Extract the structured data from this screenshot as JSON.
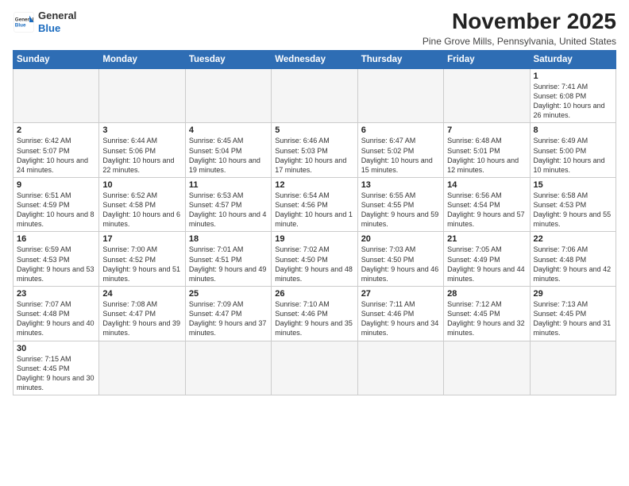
{
  "logo": {
    "general": "General",
    "blue": "Blue"
  },
  "header": {
    "month_year": "November 2025",
    "location": "Pine Grove Mills, Pennsylvania, United States"
  },
  "weekdays": [
    "Sunday",
    "Monday",
    "Tuesday",
    "Wednesday",
    "Thursday",
    "Friday",
    "Saturday"
  ],
  "weeks": [
    [
      {
        "day": "",
        "info": ""
      },
      {
        "day": "",
        "info": ""
      },
      {
        "day": "",
        "info": ""
      },
      {
        "day": "",
        "info": ""
      },
      {
        "day": "",
        "info": ""
      },
      {
        "day": "",
        "info": ""
      },
      {
        "day": "1",
        "info": "Sunrise: 7:41 AM\nSunset: 6:08 PM\nDaylight: 10 hours and 26 minutes."
      }
    ],
    [
      {
        "day": "2",
        "info": "Sunrise: 6:42 AM\nSunset: 5:07 PM\nDaylight: 10 hours and 24 minutes."
      },
      {
        "day": "3",
        "info": "Sunrise: 6:44 AM\nSunset: 5:06 PM\nDaylight: 10 hours and 22 minutes."
      },
      {
        "day": "4",
        "info": "Sunrise: 6:45 AM\nSunset: 5:04 PM\nDaylight: 10 hours and 19 minutes."
      },
      {
        "day": "5",
        "info": "Sunrise: 6:46 AM\nSunset: 5:03 PM\nDaylight: 10 hours and 17 minutes."
      },
      {
        "day": "6",
        "info": "Sunrise: 6:47 AM\nSunset: 5:02 PM\nDaylight: 10 hours and 15 minutes."
      },
      {
        "day": "7",
        "info": "Sunrise: 6:48 AM\nSunset: 5:01 PM\nDaylight: 10 hours and 12 minutes."
      },
      {
        "day": "8",
        "info": "Sunrise: 6:49 AM\nSunset: 5:00 PM\nDaylight: 10 hours and 10 minutes."
      }
    ],
    [
      {
        "day": "9",
        "info": "Sunrise: 6:51 AM\nSunset: 4:59 PM\nDaylight: 10 hours and 8 minutes."
      },
      {
        "day": "10",
        "info": "Sunrise: 6:52 AM\nSunset: 4:58 PM\nDaylight: 10 hours and 6 minutes."
      },
      {
        "day": "11",
        "info": "Sunrise: 6:53 AM\nSunset: 4:57 PM\nDaylight: 10 hours and 4 minutes."
      },
      {
        "day": "12",
        "info": "Sunrise: 6:54 AM\nSunset: 4:56 PM\nDaylight: 10 hours and 1 minute."
      },
      {
        "day": "13",
        "info": "Sunrise: 6:55 AM\nSunset: 4:55 PM\nDaylight: 9 hours and 59 minutes."
      },
      {
        "day": "14",
        "info": "Sunrise: 6:56 AM\nSunset: 4:54 PM\nDaylight: 9 hours and 57 minutes."
      },
      {
        "day": "15",
        "info": "Sunrise: 6:58 AM\nSunset: 4:53 PM\nDaylight: 9 hours and 55 minutes."
      }
    ],
    [
      {
        "day": "16",
        "info": "Sunrise: 6:59 AM\nSunset: 4:53 PM\nDaylight: 9 hours and 53 minutes."
      },
      {
        "day": "17",
        "info": "Sunrise: 7:00 AM\nSunset: 4:52 PM\nDaylight: 9 hours and 51 minutes."
      },
      {
        "day": "18",
        "info": "Sunrise: 7:01 AM\nSunset: 4:51 PM\nDaylight: 9 hours and 49 minutes."
      },
      {
        "day": "19",
        "info": "Sunrise: 7:02 AM\nSunset: 4:50 PM\nDaylight: 9 hours and 48 minutes."
      },
      {
        "day": "20",
        "info": "Sunrise: 7:03 AM\nSunset: 4:50 PM\nDaylight: 9 hours and 46 minutes."
      },
      {
        "day": "21",
        "info": "Sunrise: 7:05 AM\nSunset: 4:49 PM\nDaylight: 9 hours and 44 minutes."
      },
      {
        "day": "22",
        "info": "Sunrise: 7:06 AM\nSunset: 4:48 PM\nDaylight: 9 hours and 42 minutes."
      }
    ],
    [
      {
        "day": "23",
        "info": "Sunrise: 7:07 AM\nSunset: 4:48 PM\nDaylight: 9 hours and 40 minutes."
      },
      {
        "day": "24",
        "info": "Sunrise: 7:08 AM\nSunset: 4:47 PM\nDaylight: 9 hours and 39 minutes."
      },
      {
        "day": "25",
        "info": "Sunrise: 7:09 AM\nSunset: 4:47 PM\nDaylight: 9 hours and 37 minutes."
      },
      {
        "day": "26",
        "info": "Sunrise: 7:10 AM\nSunset: 4:46 PM\nDaylight: 9 hours and 35 minutes."
      },
      {
        "day": "27",
        "info": "Sunrise: 7:11 AM\nSunset: 4:46 PM\nDaylight: 9 hours and 34 minutes."
      },
      {
        "day": "28",
        "info": "Sunrise: 7:12 AM\nSunset: 4:45 PM\nDaylight: 9 hours and 32 minutes."
      },
      {
        "day": "29",
        "info": "Sunrise: 7:13 AM\nSunset: 4:45 PM\nDaylight: 9 hours and 31 minutes."
      }
    ],
    [
      {
        "day": "30",
        "info": "Sunrise: 7:15 AM\nSunset: 4:45 PM\nDaylight: 9 hours and 30 minutes."
      },
      {
        "day": "",
        "info": ""
      },
      {
        "day": "",
        "info": ""
      },
      {
        "day": "",
        "info": ""
      },
      {
        "day": "",
        "info": ""
      },
      {
        "day": "",
        "info": ""
      },
      {
        "day": "",
        "info": ""
      }
    ]
  ]
}
